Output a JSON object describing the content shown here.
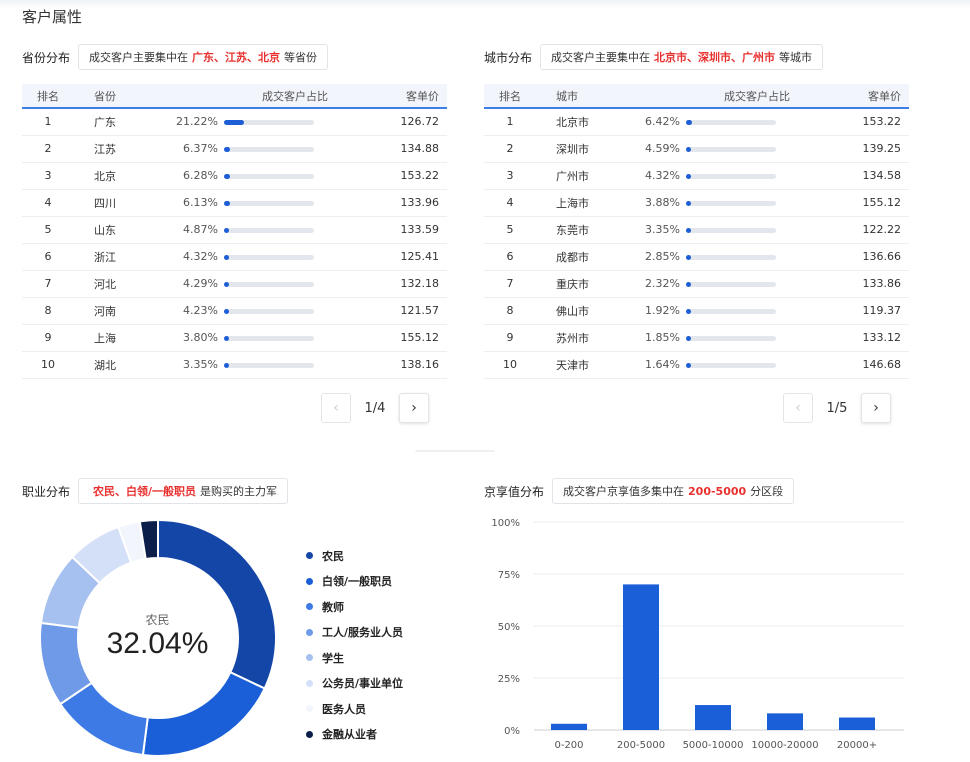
{
  "page_title": "客户属性",
  "province": {
    "label": "省份分布",
    "callout_prefix": "成交客户主要集中在",
    "callout_highlight": "广东、江苏、北京",
    "callout_suffix": "等省份",
    "headers": [
      "排名",
      "省份",
      "成交客户占比",
      "客单价"
    ],
    "rows": [
      {
        "rank": "1",
        "name": "广东",
        "pct": "21.22%",
        "share": 21.22,
        "price": "126.72"
      },
      {
        "rank": "2",
        "name": "江苏",
        "pct": "6.37%",
        "share": 6.37,
        "price": "134.88"
      },
      {
        "rank": "3",
        "name": "北京",
        "pct": "6.28%",
        "share": 6.28,
        "price": "153.22"
      },
      {
        "rank": "4",
        "name": "四川",
        "pct": "6.13%",
        "share": 6.13,
        "price": "133.96"
      },
      {
        "rank": "5",
        "name": "山东",
        "pct": "4.87%",
        "share": 4.87,
        "price": "133.59"
      },
      {
        "rank": "6",
        "name": "浙江",
        "pct": "4.32%",
        "share": 4.32,
        "price": "125.41"
      },
      {
        "rank": "7",
        "name": "河北",
        "pct": "4.29%",
        "share": 4.29,
        "price": "132.18"
      },
      {
        "rank": "8",
        "name": "河南",
        "pct": "4.23%",
        "share": 4.23,
        "price": "121.57"
      },
      {
        "rank": "9",
        "name": "上海",
        "pct": "3.80%",
        "share": 3.8,
        "price": "155.12"
      },
      {
        "rank": "10",
        "name": "湖北",
        "pct": "3.35%",
        "share": 3.35,
        "price": "138.16"
      }
    ],
    "page": "1/4"
  },
  "city": {
    "label": "城市分布",
    "callout_prefix": "成交客户主要集中在",
    "callout_highlight": "北京市、深圳市、广州市",
    "callout_suffix": "等城市",
    "headers": [
      "排名",
      "城市",
      "成交客户占比",
      "客单价"
    ],
    "rows": [
      {
        "rank": "1",
        "name": "北京市",
        "pct": "6.42%",
        "share": 6.42,
        "price": "153.22"
      },
      {
        "rank": "2",
        "name": "深圳市",
        "pct": "4.59%",
        "share": 4.59,
        "price": "139.25"
      },
      {
        "rank": "3",
        "name": "广州市",
        "pct": "4.32%",
        "share": 4.32,
        "price": "134.58"
      },
      {
        "rank": "4",
        "name": "上海市",
        "pct": "3.88%",
        "share": 3.88,
        "price": "155.12"
      },
      {
        "rank": "5",
        "name": "东莞市",
        "pct": "3.35%",
        "share": 3.35,
        "price": "122.22"
      },
      {
        "rank": "6",
        "name": "成都市",
        "pct": "2.85%",
        "share": 2.85,
        "price": "136.66"
      },
      {
        "rank": "7",
        "name": "重庆市",
        "pct": "2.32%",
        "share": 2.32,
        "price": "133.86"
      },
      {
        "rank": "8",
        "name": "佛山市",
        "pct": "1.92%",
        "share": 1.92,
        "price": "119.37"
      },
      {
        "rank": "9",
        "name": "苏州市",
        "pct": "1.85%",
        "share": 1.85,
        "price": "133.12"
      },
      {
        "rank": "10",
        "name": "天津市",
        "pct": "1.64%",
        "share": 1.64,
        "price": "146.68"
      }
    ],
    "page": "1/5"
  },
  "occupation": {
    "label": "职业分布",
    "callout_highlight": "农民、白领/一般职员",
    "callout_suffix": "是购买的主力军",
    "center_category": "农民",
    "center_value": "32.04%"
  },
  "jingxiang": {
    "label": "京享值分布",
    "callout_prefix": "成交客户京享值多集中在",
    "callout_highlight": "200-5000",
    "callout_suffix": "分区段"
  },
  "chart_data": [
    {
      "type": "pie",
      "categories": [
        "农民",
        "白领/一般职员",
        "教师",
        "工人/服务业人员",
        "学生",
        "公务员/事业单位",
        "医务人员",
        "金融从业者"
      ],
      "values": [
        32.04,
        20.0,
        13.5,
        11.5,
        10.0,
        7.5,
        3.0,
        2.46
      ],
      "colors": [
        "#1446a8",
        "#1b5fd8",
        "#3d7ae6",
        "#6f9ae8",
        "#a6c0f0",
        "#d3e0f8",
        "#f2f5fb",
        "#0b1f4a"
      ],
      "legend_position": "right",
      "donut": true
    },
    {
      "type": "bar",
      "categories": [
        "0-200",
        "200-5000",
        "5000-10000",
        "10000-20000",
        "20000+"
      ],
      "values": [
        3,
        70,
        12,
        8,
        6
      ],
      "ylim": [
        0,
        100
      ],
      "yticks": [
        "0%",
        "25%",
        "50%",
        "75%",
        "100%"
      ],
      "color": "#1b5fd8",
      "grid": true
    }
  ]
}
